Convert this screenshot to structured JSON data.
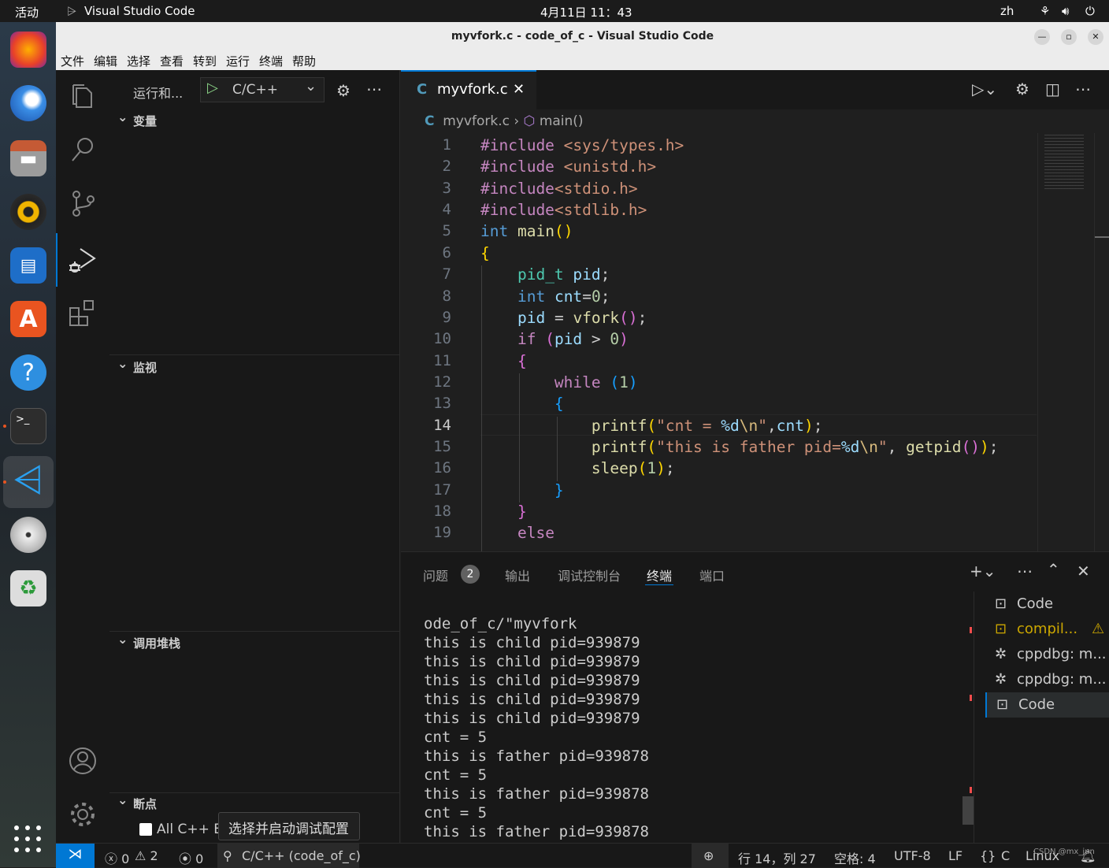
{
  "topbar": {
    "activities": "活动",
    "app": "Visual Studio Code",
    "clock": "4月11日  11：43",
    "lang": "zh"
  },
  "window": {
    "title": "myvfork.c - code_of_c - Visual Studio Code"
  },
  "menu": [
    "文件",
    "编辑",
    "选择",
    "查看",
    "转到",
    "运行",
    "终端",
    "帮助"
  ],
  "sidebar": {
    "run_label": "运行和...",
    "config": "C/C++",
    "sections": {
      "variables": "变量",
      "watch": "监视",
      "callstack": "调用堆栈",
      "breakpoints": "断点"
    },
    "breakpoint_item": "All C++ Ex",
    "tooltip": "选择并启动调试配置"
  },
  "editor": {
    "tab": "myvfork.c",
    "breadcrumb_file": "myvfork.c",
    "breadcrumb_symbol": "main()",
    "lines": [
      "1",
      "2",
      "3",
      "4",
      "5",
      "6",
      "7",
      "8",
      "9",
      "10",
      "11",
      "12",
      "13",
      "14",
      "15",
      "16",
      "17",
      "18",
      "19"
    ]
  },
  "panel": {
    "tabs": {
      "problems": "问题",
      "problems_count": "2",
      "output": "输出",
      "debug_console": "调试控制台",
      "terminal": "终端",
      "ports": "端口"
    },
    "terminal_lines": [
      "ode_of_c/\"myvfork",
      "this is child pid=939879",
      "this is child pid=939879",
      "this is child pid=939879",
      "this is child pid=939879",
      "this is child pid=939879",
      "cnt = 5",
      "this is father pid=939878",
      "cnt = 5",
      "this is father pid=939878",
      "cnt = 5",
      "this is father pid=939878"
    ],
    "terminals": [
      "Code",
      "compil...",
      "cppdbg: m...",
      "cppdbg: m...",
      "Code"
    ]
  },
  "status": {
    "errors": "0",
    "warnings": "2",
    "ports": "0",
    "debug": "C/C++ (code_of_c)",
    "position": "行 14，列 27",
    "spaces": "空格: 4",
    "encoding": "UTF-8",
    "eol": "LF",
    "lang": "C",
    "os": "Linux",
    "watermark": "CSDN @mx_jun"
  },
  "colors": {
    "accent": "#0078d4",
    "keyword": "#569cd6",
    "control": "#c586c0",
    "string": "#ce9178",
    "func": "#dcdcaa",
    "var": "#9cdcfe",
    "type": "#4ec9b0",
    "number": "#b5cea8"
  }
}
